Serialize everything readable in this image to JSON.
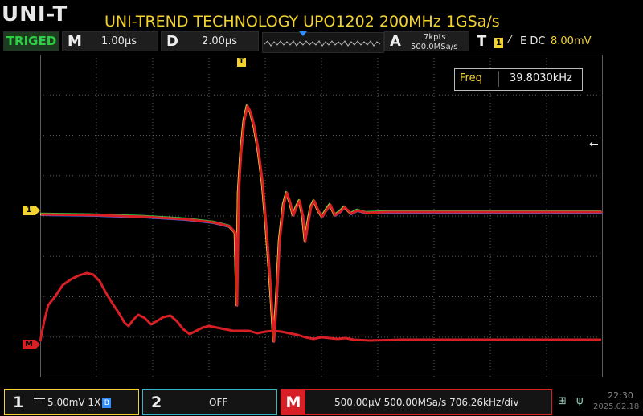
{
  "brand": {
    "logo_text": "UNI-T"
  },
  "title": "UNI-TREND TECHNOLOGY UPO1202 200MHz 1GSa/s",
  "status": {
    "trigger_state": "TRIGED",
    "main_key": "M",
    "main_timebase": "1.00µs",
    "delay_key": "D",
    "delay_value": "2.00µs",
    "acq_key": "A",
    "acq_points": "7kpts",
    "acq_rate": "500.0MSa/s",
    "trig_key": "T",
    "trig_source": "1",
    "trig_mode": "E DC",
    "trig_level": "8.00mV"
  },
  "measurement": {
    "label": "Freq",
    "value": "39.8030kHz"
  },
  "markers": {
    "ch1": "1",
    "math": "M",
    "trigger": "T"
  },
  "bottom": {
    "ch1_num": "1",
    "ch1_scale": "5.00mV 1X",
    "ch1_bw": "B",
    "ch2_num": "2",
    "ch2_state": "OFF",
    "math_key": "M",
    "math_info": "500.00µV 500.00MSa/s 706.26kHz/div",
    "time": "22:30",
    "date": "2025.02.18"
  },
  "colors": {
    "ch1": "#f2d230",
    "math": "#d81f26",
    "ch2": "#37b6c8",
    "triggered": "#2fcf45"
  },
  "icons": [
    "network-icon",
    "usb-icon",
    "falling-edge-icon"
  ]
}
